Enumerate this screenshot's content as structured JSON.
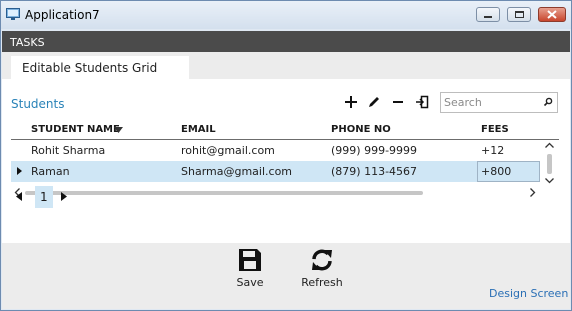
{
  "window": {
    "title": "Application7"
  },
  "taskbar": {
    "label": "TASKS"
  },
  "tabs": [
    {
      "label": "Editable Students Grid"
    }
  ],
  "grid": {
    "title": "Students",
    "search_placeholder": "Search",
    "columns": [
      "STUDENT NAME",
      "EMAIL",
      "PHONE NO",
      "FEES"
    ],
    "rows": [
      {
        "name": "Rohit Sharma",
        "email": "rohit@gmail.com",
        "phone": "(999) 999-9999",
        "fees": "+12"
      },
      {
        "name": "Raman",
        "email": "Sharma@gmail.com",
        "phone": "(879) 113-4567",
        "fees": "+800"
      }
    ]
  },
  "pager": {
    "current_page": "1"
  },
  "actions": {
    "save_label": "Save",
    "refresh_label": "Refresh"
  },
  "footer": {
    "design_link": "Design Screen"
  },
  "colors": {
    "accent": "#2a83b8",
    "selection": "#cfe6f5",
    "taskbar": "#4b4b4b"
  }
}
